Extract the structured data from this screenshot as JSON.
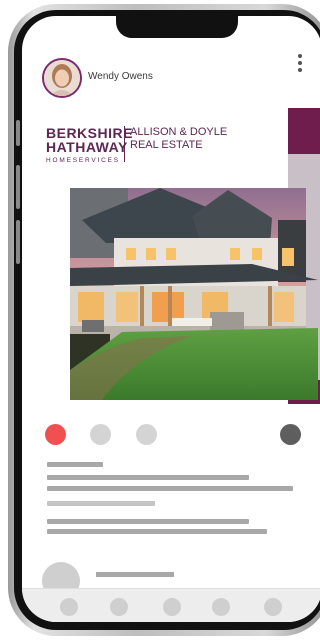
{
  "post": {
    "author_name": "Wendy Owens",
    "brand": {
      "line1": "BERKSHIRE",
      "line2": "HATHAWAY",
      "line3": "HOMESERVICES",
      "office_line1": "ALLISON & DOYLE",
      "office_line2": "REAL ESTATE"
    }
  },
  "colors": {
    "brand_maroon": "#6e1d4c",
    "active_dot": "#f05050",
    "inactive_dot": "#d4d4d4",
    "dark_dot": "#5e5e5e"
  },
  "icons": {
    "more": "vertical-ellipsis",
    "bottom_nav": [
      "nav-dot",
      "nav-dot",
      "nav-dot",
      "nav-dot",
      "nav-dot"
    ]
  }
}
